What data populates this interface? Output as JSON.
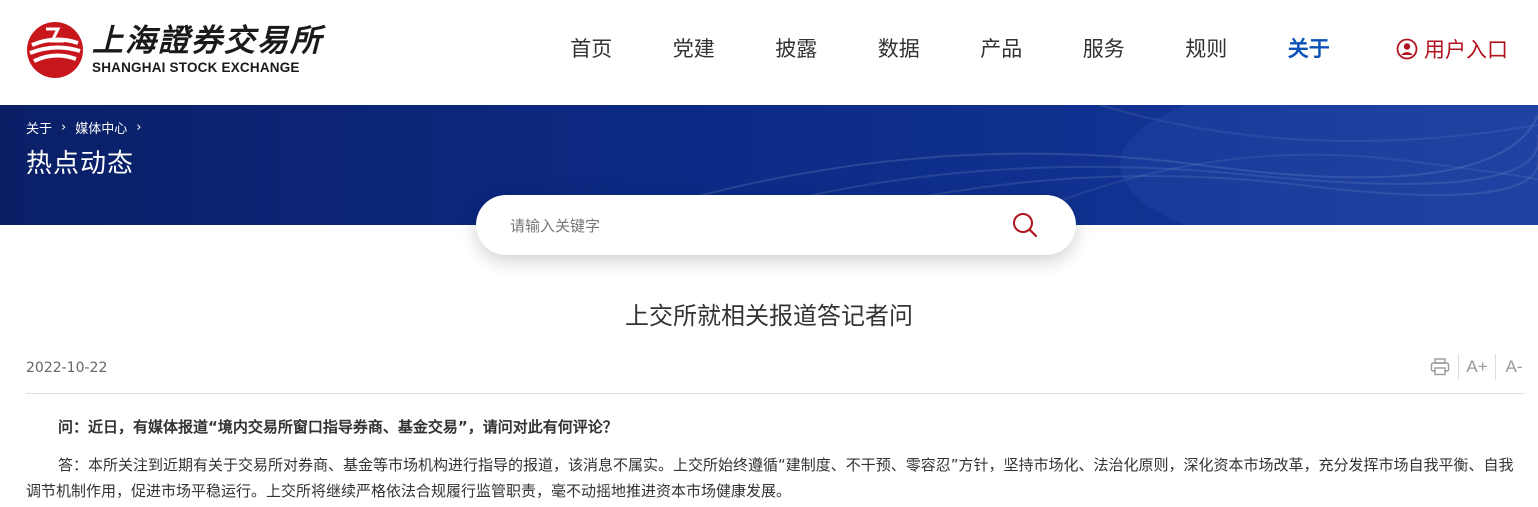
{
  "header": {
    "logo_cn": "上海證券交易所",
    "logo_en": "SHANGHAI STOCK EXCHANGE",
    "nav": [
      {
        "label": "首页",
        "active": false
      },
      {
        "label": "党建",
        "active": false
      },
      {
        "label": "披露",
        "active": false
      },
      {
        "label": "数据",
        "active": false
      },
      {
        "label": "产品",
        "active": false
      },
      {
        "label": "服务",
        "active": false
      },
      {
        "label": "规则",
        "active": false
      },
      {
        "label": "关于",
        "active": true
      }
    ],
    "user_entry": "用户入口",
    "user_icon": "user-circle-icon"
  },
  "banner": {
    "breadcrumb": [
      "关于",
      "媒体中心"
    ],
    "title": "热点动态"
  },
  "search": {
    "placeholder": "请输入关键字",
    "icon": "search-icon"
  },
  "article": {
    "title": "上交所就相关报道答记者问",
    "date": "2022-10-22",
    "tools": {
      "print_icon": "print-icon",
      "font_larger": "A+",
      "font_smaller": "A-"
    },
    "question": "问：近日，有媒体报道“境内交易所窗口指导券商、基金交易”，请问对此有何评论？",
    "answer": "答：本所关注到近期有关于交易所对券商、基金等市场机构进行指导的报道，该消息不属实。上交所始终遵循“建制度、不干预、零容忍”方针，坚持市场化、法治化原则，深化资本市场改革，充分发挥市场自我平衡、自我调节机制作用，促进市场平稳运行。上交所将继续严格依法合规履行监管职责，毫不动摇地推进资本市场健康发展。"
  },
  "colors": {
    "brand_red": "#b0131f",
    "active_blue": "#0b52b8",
    "banner_navy": "#0c2a85"
  }
}
